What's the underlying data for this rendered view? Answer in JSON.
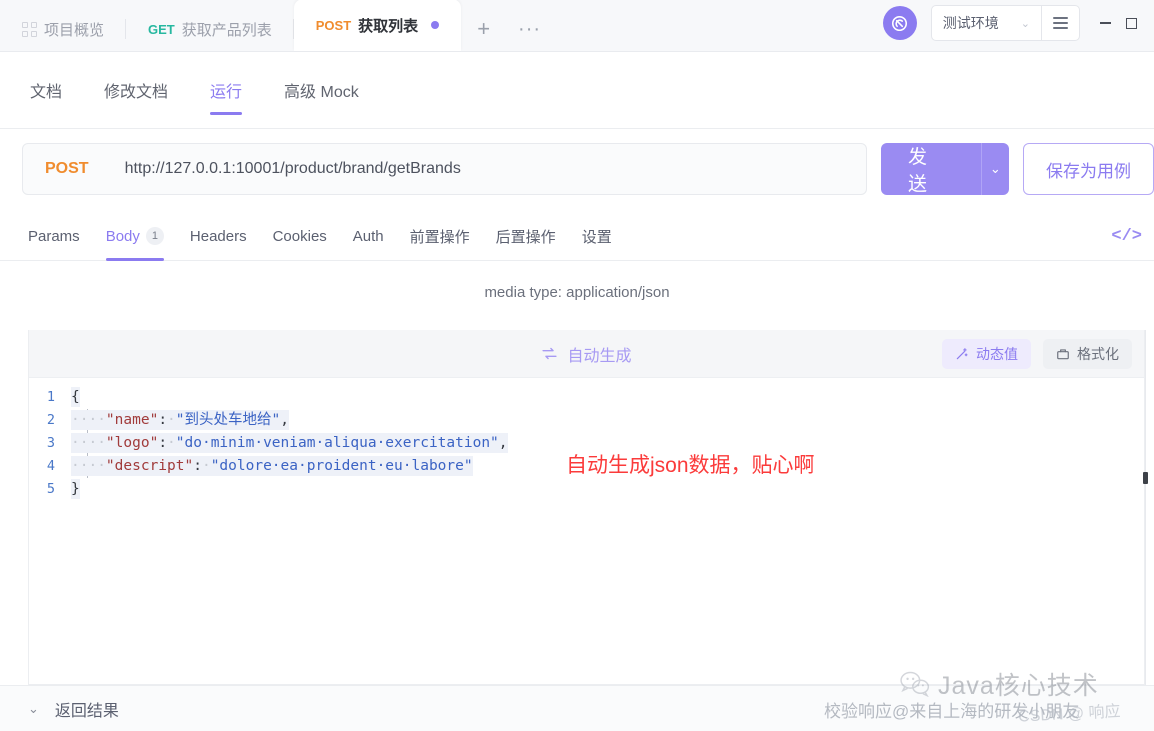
{
  "titlebar": {
    "tabs": [
      {
        "icon": "grid-icon",
        "method": "",
        "label": "项目概览",
        "active": false,
        "unsaved": false
      },
      {
        "icon": "",
        "method": "GET",
        "label": "获取产品列表",
        "active": false,
        "unsaved": false
      },
      {
        "icon": "",
        "method": "POST",
        "label": "获取列表",
        "active": true,
        "unsaved": true
      }
    ],
    "add_label": "+",
    "more_label": "···",
    "sync_icon": "sync-icon",
    "environment": "测试环境",
    "env_chevron": "⌄",
    "menu_icon": "hamburger-icon",
    "minimize_label": "—",
    "maximize_label": "▭"
  },
  "doc_tabs": [
    {
      "label": "文档",
      "active": false
    },
    {
      "label": "修改文档",
      "active": false
    },
    {
      "label": "运行",
      "active": true
    },
    {
      "label": "高级 Mock",
      "active": false
    }
  ],
  "request": {
    "method": "POST",
    "url": "http://127.0.0.1:10001/product/brand/getBrands",
    "send_label": "发 送",
    "send_dropdown": "⌄",
    "save_case_label": "保存为用例"
  },
  "param_tabs": [
    {
      "label": "Params",
      "badge": "",
      "active": false
    },
    {
      "label": "Body",
      "badge": "1",
      "active": true
    },
    {
      "label": "Headers",
      "badge": "",
      "active": false
    },
    {
      "label": "Cookies",
      "badge": "",
      "active": false
    },
    {
      "label": "Auth",
      "badge": "",
      "active": false
    },
    {
      "label": "前置操作",
      "badge": "",
      "active": false
    },
    {
      "label": "后置操作",
      "badge": "",
      "active": false
    },
    {
      "label": "设置",
      "badge": "",
      "active": false
    }
  ],
  "code_toggle_label": "</>",
  "media_type": "media type: application/json",
  "editor_toolbar": {
    "autogen_label": "自动生成",
    "autogen_icon": "refresh-swap-icon",
    "dynamic_value_label": "动态值",
    "dynamic_value_icon": "magic-wand-icon",
    "format_label": "格式化",
    "format_icon": "format-icon"
  },
  "editor": {
    "lines": [
      {
        "num": "1",
        "segments": [
          {
            "cls": "p",
            "text": "{"
          }
        ]
      },
      {
        "num": "2",
        "segments": [
          {
            "cls": "dotsp",
            "text": "····"
          },
          {
            "cls": "k",
            "text": "\"name\""
          },
          {
            "cls": "p",
            "text": ":"
          },
          {
            "cls": "dotsp",
            "text": "·"
          },
          {
            "cls": "s",
            "text": "\"到头处车地给\""
          },
          {
            "cls": "p",
            "text": ","
          }
        ]
      },
      {
        "num": "3",
        "segments": [
          {
            "cls": "dotsp",
            "text": "····"
          },
          {
            "cls": "k",
            "text": "\"logo\""
          },
          {
            "cls": "p",
            "text": ":"
          },
          {
            "cls": "dotsp",
            "text": "·"
          },
          {
            "cls": "s",
            "text": "\"do·minim·veniam·aliqua·exercitation\""
          },
          {
            "cls": "p",
            "text": ","
          }
        ]
      },
      {
        "num": "4",
        "segments": [
          {
            "cls": "dotsp",
            "text": "····"
          },
          {
            "cls": "k",
            "text": "\"descript\""
          },
          {
            "cls": "p",
            "text": ":"
          },
          {
            "cls": "dotsp",
            "text": "·"
          },
          {
            "cls": "s",
            "text": "\"dolore·ea·proident·eu·labore\""
          }
        ]
      },
      {
        "num": "5",
        "segments": [
          {
            "cls": "p",
            "text": "}"
          }
        ]
      }
    ]
  },
  "annotation": "自动生成json数据，贴心啊",
  "bottom": {
    "chevron": "⌄",
    "label": "返回结果"
  },
  "watermarks": {
    "brand": "Java核心技术",
    "brand_icon": "wechat-icon",
    "csdn": "校验响应@来自上海的研发小朋友",
    "csdn_site": "CSDN @ 响应"
  },
  "colors": {
    "accent": "#8b7bf0",
    "method_post": "#f08c2e",
    "method_get": "#27b8a0",
    "annotation_red": "#fb3b3b",
    "json_key": "#a13b3b",
    "json_string": "#3b63c4"
  }
}
